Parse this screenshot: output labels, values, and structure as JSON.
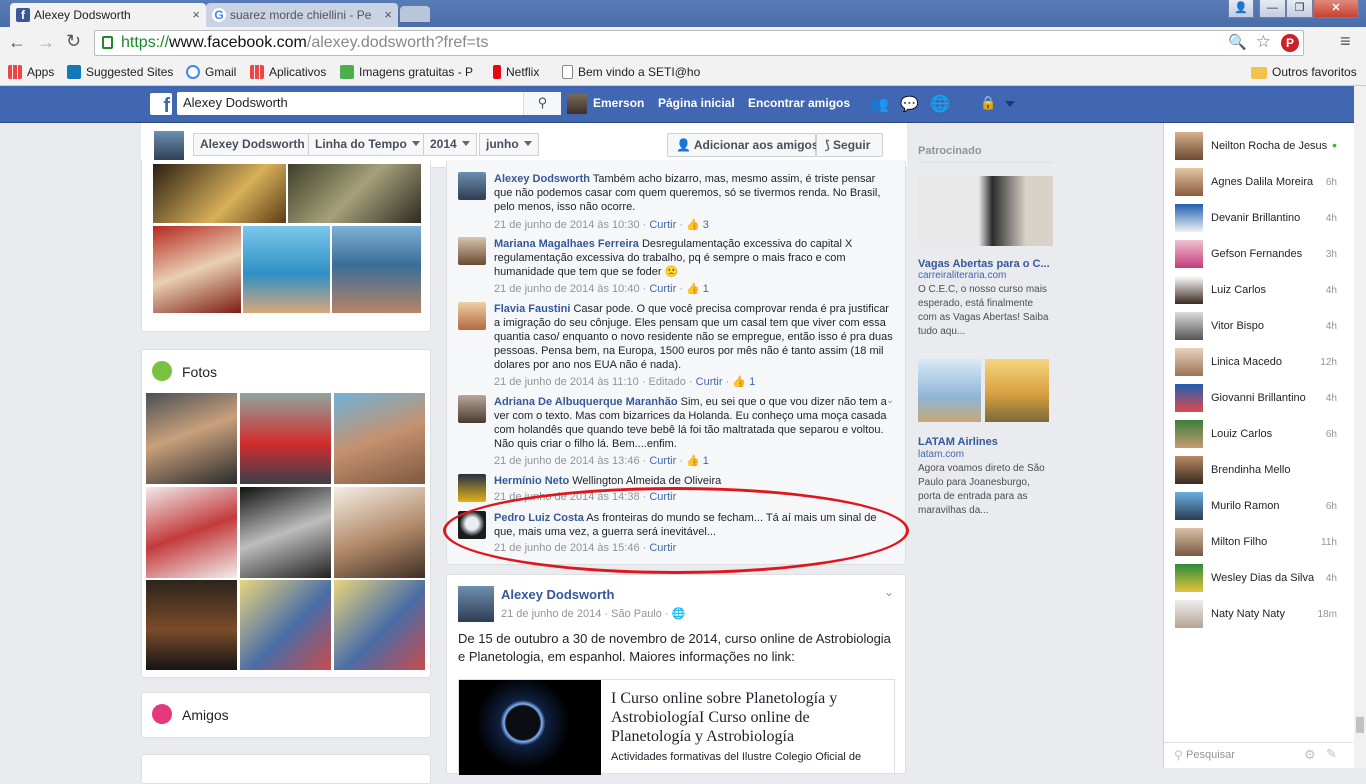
{
  "browser": {
    "tabs": [
      {
        "title": "Alexey Dodsworth",
        "active": true
      },
      {
        "title": "suarez morde chiellini - Pe",
        "active": false
      }
    ],
    "url_prefix": "https://",
    "url_host": "www.facebook.com",
    "url_path": "/alexey.dodsworth?fref=ts",
    "bookmarks": [
      "Apps",
      "Suggested Sites",
      "Gmail",
      "Aplicativos",
      "Imagens gratuitas - P",
      "Netflix",
      "Bem vindo a SETI@ho"
    ],
    "other_bookmarks": "Outros favoritos"
  },
  "fb": {
    "search_value": "Alexey Dodsworth",
    "user_name": "Emerson",
    "nav_home": "Página inicial",
    "nav_find_friends": "Encontrar amigos"
  },
  "timeline": {
    "name": "Alexey Dodsworth",
    "dropdown_timeline": "Linha do Tempo",
    "dropdown_year": "2014",
    "dropdown_month": "junho",
    "add_friend": "Adicionar aos amigos",
    "follow": "Seguir",
    "photos_title": "Fotos",
    "friends_title": "Amigos"
  },
  "comments": [
    {
      "author": "Alexey Dodsworth",
      "text": "Também acho bizarro, mas, mesmo assim, é triste pensar que não podemos casar com quem queremos, só se tivermos renda. No Brasil, pelo menos, isso não ocorre.",
      "time": "21 de junho de 2014 às 10:30",
      "action": "Curtir",
      "likes": "3",
      "edited": ""
    },
    {
      "author": "Mariana Magalhaes Ferreira",
      "text": "Desregulamentação excessiva do capital X regulamentação excessiva do trabalho, pq é sempre o mais fraco e com humanidade que tem que se foder 🙁",
      "time": "21 de junho de 2014 às 10:40",
      "action": "Curtir",
      "likes": "1",
      "edited": ""
    },
    {
      "author": "Flavia Faustini",
      "text": "Casar pode. O que você precisa comprovar renda é pra justificar a imigração do seu cônjuge. Eles pensam que um casal tem que viver com essa quantia caso/ enquanto o novo residente não se empregue, então isso é pra duas pessoas. Pensa bem, na Europa, 1500 euros por mês não é tanto assim (18 mil dolares por ano nos EUA não é nada).",
      "time": "21 de junho de 2014 às 11:10",
      "action": "Curtir",
      "likes": "1",
      "edited": "Editado"
    },
    {
      "author": "Adriana De Albuquerque Maranhão",
      "text": "Sim, eu sei que o que vou dizer não tem a ver com o texto. Mas com bizarrices da Holanda. Eu conheço uma moça casada com holandês que quando teve bebê lá foi tão maltratada que separou e voltou. Não quis criar o filho lá. Bem....enfim.",
      "time": "21 de junho de 2014 às 13:46",
      "action": "Curtir",
      "likes": "1",
      "edited": ""
    },
    {
      "author": "Hermínio Neto",
      "text": "Wellington Almeida de Oliveira",
      "time": "21 de junho de 2014 às 14:38",
      "action": "Curtir",
      "likes": "",
      "edited": ""
    },
    {
      "author": "Pedro Luiz Costa",
      "text": "As fronteiras do mundo se fecham... Tá aí mais um sinal de que, mais uma vez, a guerra será inevitável...",
      "time": "21 de junho de 2014 às 15:46",
      "action": "Curtir",
      "likes": "",
      "edited": ""
    }
  ],
  "post": {
    "author": "Alexey Dodsworth",
    "date": "21 de junho de 2014",
    "location": "São Paulo",
    "text": "De 15 de outubro a 30 de novembro de 2014, curso online de Astrobiologia e Planetologia, em espanhol. Maiores informações no link:",
    "link_title": "I Curso online sobre Planetología y AstrobiologíaI Curso online de Planetología y Astrobiología",
    "link_desc": "Actividades formativas del Ilustre Colegio Oficial de"
  },
  "sponsored": {
    "title": "Patrocinado",
    "ad1": {
      "title": "Vagas Abertas para o C...",
      "domain": "carreiraliteraria.com",
      "text": "O C.E.C, o nosso curso mais esperado, está finalmente com as Vagas Abertas! Saiba tudo aqu..."
    },
    "ad2": {
      "title": "LATAM Airlines",
      "domain": "latam.com",
      "text": "Agora voamos direto de São Paulo para Joanesburgo, porta de entrada para as maravilhas da..."
    }
  },
  "chat": {
    "friends": [
      {
        "name": "Neilton Rocha de Jesus",
        "status": "•"
      },
      {
        "name": "Agnes Dalila Moreira",
        "status": "6h"
      },
      {
        "name": "Devanir Brillantino",
        "status": "4h"
      },
      {
        "name": "Gefson Fernandes",
        "status": "3h"
      },
      {
        "name": "Luiz Carlos",
        "status": "4h"
      },
      {
        "name": "Vitor Bispo",
        "status": "4h"
      },
      {
        "name": "Linica Macedo",
        "status": "12h"
      },
      {
        "name": "Giovanni Brillantino",
        "status": "4h"
      },
      {
        "name": "Louiz Carlos",
        "status": "6h"
      },
      {
        "name": "Brendinha Mello",
        "status": ""
      },
      {
        "name": "Murilo Ramon",
        "status": "6h"
      },
      {
        "name": "Milton Filho",
        "status": "11h"
      },
      {
        "name": "Wesley Dias da Silva",
        "status": "4h"
      },
      {
        "name": "Naty Naty Naty",
        "status": "18m"
      }
    ],
    "search_placeholder": "Pesquisar"
  },
  "colors": {
    "fb_blue": "#4267b2",
    "link": "#365899",
    "annotation": "#e0161f"
  }
}
